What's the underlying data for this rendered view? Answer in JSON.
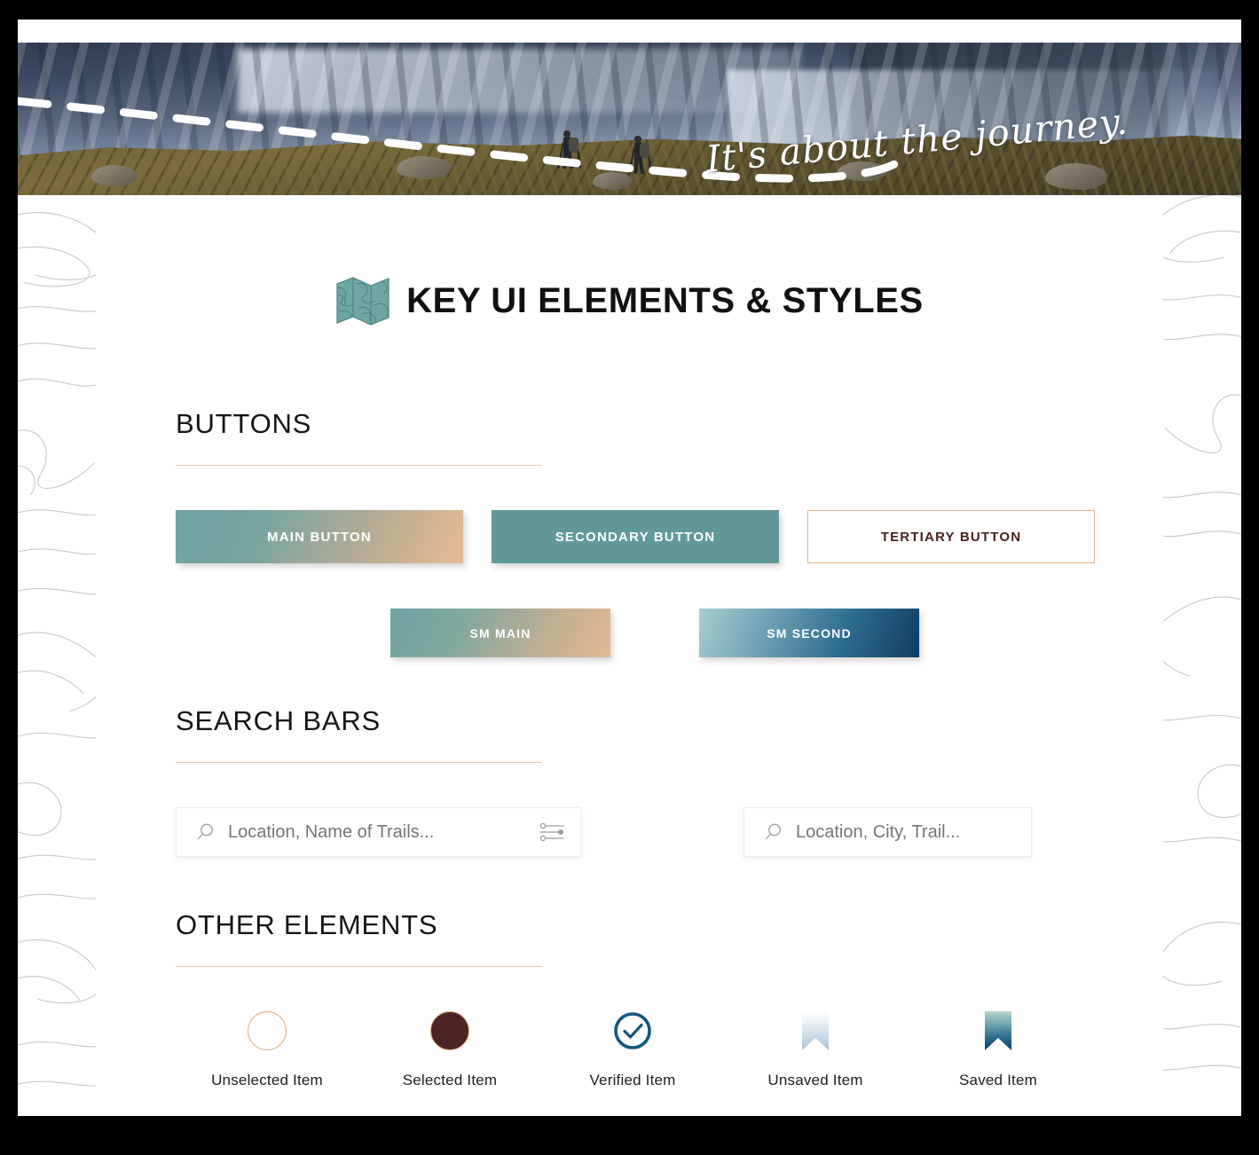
{
  "hero": {
    "tagline": "It's about the journey.",
    "alt": "hikers-on-mountain-ridge-photo"
  },
  "header": {
    "title": "KEY UI ELEMENTS & STYLES",
    "icon": "folded-map-icon"
  },
  "sections": [
    {
      "id": "buttons",
      "title": "BUTTONS"
    },
    {
      "id": "search",
      "title": "SEARCH BARS"
    },
    {
      "id": "other",
      "title": "OTHER ELEMENTS"
    }
  ],
  "buttons": {
    "large": [
      {
        "name": "main-button",
        "label": "MAIN BUTTON"
      },
      {
        "name": "secondary-button",
        "label": "SECONDARY BUTTON"
      },
      {
        "name": "tertiary-button",
        "label": "TERTIARY BUTTON"
      }
    ],
    "small": [
      {
        "name": "sm-main-button",
        "label": "SM MAIN"
      },
      {
        "name": "sm-second-button",
        "label": "SM SECOND"
      }
    ]
  },
  "search": {
    "primary": {
      "placeholder": "Location, Name of Trails...",
      "value": "",
      "search_icon": "magnifier-icon",
      "filter_icon": "sliders-filter-icon"
    },
    "secondary": {
      "placeholder": "Location, City, Trail...",
      "value": "",
      "search_icon": "magnifier-icon"
    }
  },
  "other_elements": [
    {
      "name": "unselected-item",
      "label": "Unselected Item",
      "icon": "circle-outline-icon"
    },
    {
      "name": "selected-item",
      "label": "Selected Item",
      "icon": "circle-filled-icon"
    },
    {
      "name": "verified-item",
      "label": "Verified Item",
      "icon": "check-circle-icon"
    },
    {
      "name": "unsaved-item",
      "label": "Unsaved Item",
      "icon": "bookmark-outline-icon"
    },
    {
      "name": "saved-item",
      "label": "Saved Item",
      "icon": "bookmark-filled-icon"
    }
  ],
  "colors": {
    "teal": "#62989a",
    "tan": "#e2b994",
    "tan_rule": "#e8c9ac",
    "maroon": "#4d2323",
    "navy": "#14567f",
    "tertiary_border": "#dfb58c",
    "placeholder_text": "#b8b8b8",
    "canvas": "#000000",
    "page": "#ffffff"
  }
}
